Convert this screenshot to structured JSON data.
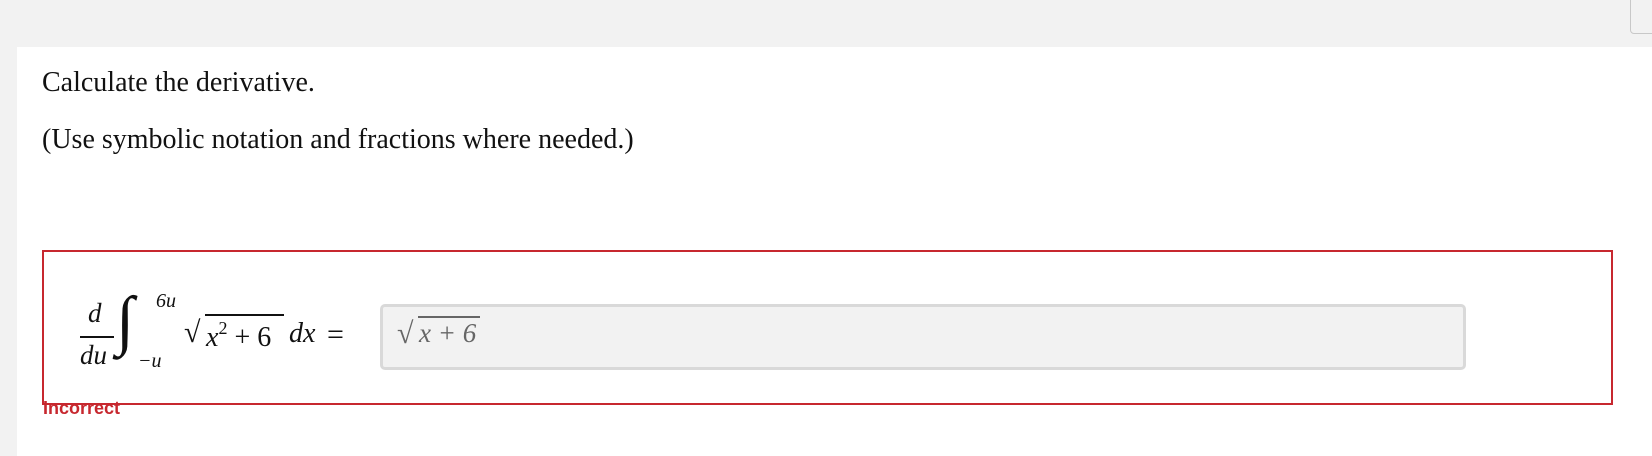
{
  "question": {
    "instruction": "Calculate the derivative.",
    "hint": "(Use symbolic notation and fractions where needed.)"
  },
  "expression": {
    "numerator": "d",
    "denominator": "du",
    "integral_sign": "∫",
    "upper_limit": "6u",
    "lower_limit": "−u",
    "sqrt_sign": "√",
    "radicand_base": "x",
    "radicand_exponent": "2",
    "radicand_rest": " + 6",
    "differential": "dx",
    "equals": "="
  },
  "answer": {
    "sqrt_sign": "√",
    "radicand": "x + 6"
  },
  "feedback": {
    "status": "Incorrect",
    "color": "#c7282f"
  }
}
